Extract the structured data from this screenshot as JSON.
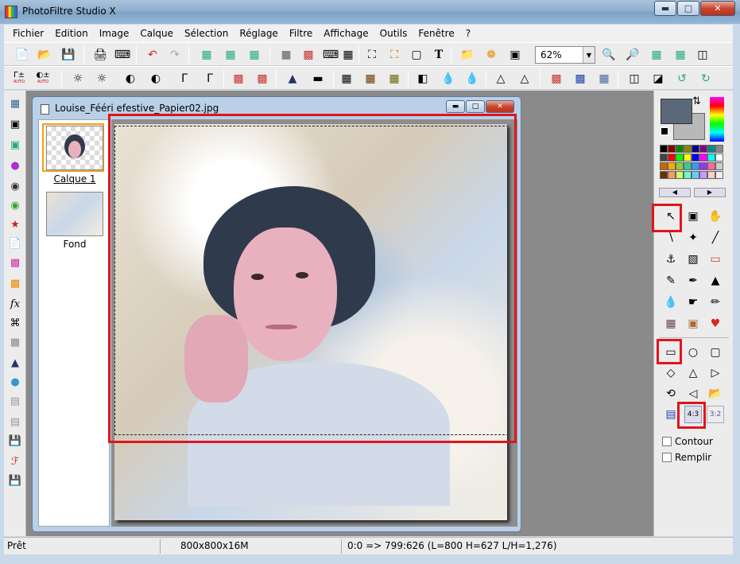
{
  "window": {
    "title": "PhotoFiltre Studio X"
  },
  "menu": [
    "Fichier",
    "Edition",
    "Image",
    "Calque",
    "Sélection",
    "Réglage",
    "Filtre",
    "Affichage",
    "Outils",
    "Fenêtre",
    "?"
  ],
  "toolbar": {
    "zoom_value": "62%"
  },
  "toolbar2": {
    "auto1": "AUTO",
    "auto2": "AUTO"
  },
  "document": {
    "title": "Louise_Fééri efestive_Papier02.jpg",
    "layers": [
      {
        "label": "Calque 1",
        "selected": true
      },
      {
        "label": "Fond",
        "selected": false
      }
    ]
  },
  "tool_options": {
    "outline_label": "Contour",
    "fill_label": "Remplir",
    "ratio_a": "4:3",
    "ratio_b": "3:2"
  },
  "colors": {
    "foreground": "#5b6879",
    "background": "#b8b8b8",
    "highlight": "#e0151b"
  },
  "status": {
    "ready": "Prêt",
    "size": "800x800x16M",
    "coords": "0:0 => 799:626 (L=800  H=627  L/H=1,276)"
  }
}
